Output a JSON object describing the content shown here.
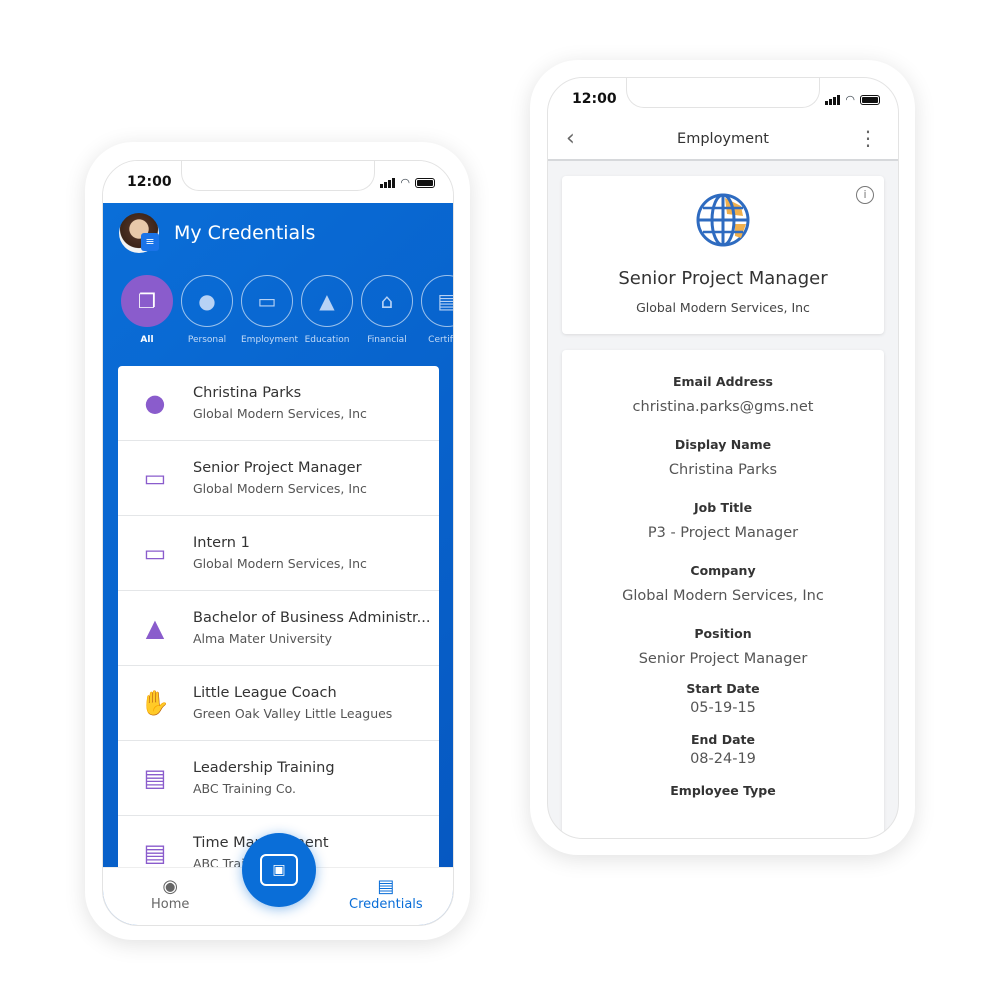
{
  "left_phone": {
    "status_time": "12:00",
    "header": {
      "title": "My Credentials"
    },
    "categories": [
      {
        "label": "All",
        "icon": "stack-icon",
        "active": true
      },
      {
        "label": "Personal",
        "icon": "person-icon"
      },
      {
        "label": "Employment",
        "icon": "briefcase-icon"
      },
      {
        "label": "Education",
        "icon": "graduation-cap-icon"
      },
      {
        "label": "Financial",
        "icon": "bank-icon"
      },
      {
        "label": "Certifica",
        "icon": "certificate-icon"
      }
    ],
    "credentials": [
      {
        "title": "Christina Parks",
        "subtitle": "Global Modern Services, Inc",
        "icon": "person-icon"
      },
      {
        "title": "Senior Project Manager",
        "subtitle": "Global Modern Services, Inc",
        "icon": "briefcase-icon"
      },
      {
        "title": "Intern 1",
        "subtitle": "Global Modern Services, Inc",
        "icon": "briefcase-icon"
      },
      {
        "title": "Bachelor of Business Administr...",
        "subtitle": "Alma Mater University",
        "icon": "graduation-cap-icon"
      },
      {
        "title": "Little League Coach",
        "subtitle": "Green Oak Valley Little Leagues",
        "icon": "handshake-icon"
      },
      {
        "title": "Leadership Training",
        "subtitle": "ABC Training Co.",
        "icon": "certificate-icon"
      },
      {
        "title": "Time Management",
        "subtitle": "ABC Training Co.",
        "icon": "certificate-icon"
      }
    ],
    "bottom_nav": {
      "home": "Home",
      "credentials": "Credentials"
    },
    "colors": {
      "primary": "#0a6ed8",
      "accent": "#8a5ccc"
    }
  },
  "right_phone": {
    "status_time": "12:00",
    "title": "Employment",
    "credential": {
      "title": "Senior Project Manager",
      "issuer": "Global Modern Services, Inc"
    },
    "fields": [
      {
        "label": "Email Address",
        "value": "christina.parks@gms.net"
      },
      {
        "label": "Display Name",
        "value": "Christina Parks"
      },
      {
        "label": "Job Title",
        "value": "P3 - Project Manager"
      },
      {
        "label": "Company",
        "value": "Global Modern Services, Inc"
      },
      {
        "label": "Position",
        "value": "Senior Project Manager"
      },
      {
        "label": "Start Date",
        "value": "05-19-15"
      },
      {
        "label": "End Date",
        "value": "08-24-19"
      },
      {
        "label": "Employee Type",
        "value": ""
      }
    ]
  }
}
